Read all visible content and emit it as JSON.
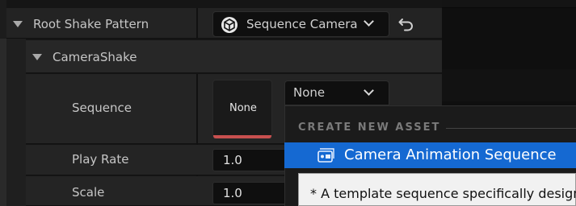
{
  "colors": {
    "panel": "#242424",
    "field": "#0f0f0f",
    "highlight": "#1569d2",
    "accent_red": "#c8504f",
    "tooltip_bg": "#f1f1f1"
  },
  "rows": {
    "root_shake_pattern": {
      "label": "Root Shake Pattern",
      "value": "Sequence Camera S",
      "icon": "sequence-camera-shake-icon",
      "reset_icon": "reset-arrow-icon"
    },
    "camera_shake": {
      "label": "CameraShake"
    },
    "sequence": {
      "label": "Sequence",
      "thumbnail_text": "None",
      "combo_value": "None"
    },
    "play_rate": {
      "label": "Play Rate",
      "value": "1.0"
    },
    "scale": {
      "label": "Scale",
      "value": "1.0"
    }
  },
  "dropdown": {
    "header": "CREATE NEW ASSET",
    "items": [
      {
        "label": "Camera Animation Sequence",
        "icon": "camera-animation-sequence-icon"
      }
    ],
    "tooltip": "* A template sequence specifically design"
  }
}
